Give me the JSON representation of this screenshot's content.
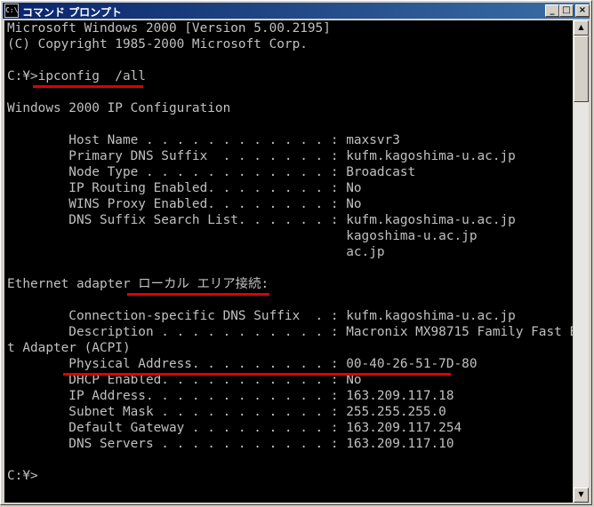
{
  "window": {
    "title": "コマンド プロンプト",
    "icon_text": "C:\\",
    "icon": "console-app-icon",
    "buttons": {
      "minimize": {
        "glyph": "_",
        "icon": "minimize-icon"
      },
      "maximize": {
        "glyph": "□",
        "icon": "maximize-icon"
      },
      "close": {
        "glyph": "×",
        "icon": "close-icon"
      }
    }
  },
  "console": {
    "lines": [
      "Microsoft Windows 2000 [Version 5.00.2195]",
      "(C) Copyright 1985-2000 Microsoft Corp.",
      "",
      "C:¥>ipconfig  /all",
      "",
      "Windows 2000 IP Configuration",
      "",
      "        Host Name . . . . . . . . . . . . : maxsvr3",
      "        Primary DNS Suffix  . . . . . . . : kufm.kagoshima-u.ac.jp",
      "        Node Type . . . . . . . . . . . . : Broadcast",
      "        IP Routing Enabled. . . . . . . . : No",
      "        WINS Proxy Enabled. . . . . . . . : No",
      "        DNS Suffix Search List. . . . . . : kufm.kagoshima-u.ac.jp",
      "                                            kagoshima-u.ac.jp",
      "                                            ac.jp",
      "",
      "Ethernet adapter ローカル エリア接続:",
      "",
      "        Connection-specific DNS Suffix  . : kufm.kagoshima-u.ac.jp",
      "        Description . . . . . . . . . . . : Macronix MX98715 Family Fast Etherne",
      "t Adapter (ACPI)",
      "        Physical Address. . . . . . . . . : 00-40-26-51-7D-80",
      "        DHCP Enabled. . . . . . . . . . . : No",
      "        IP Address. . . . . . . . . . . . : 163.209.117.18",
      "        Subnet Mask . . . . . . . . . . . : 255.255.255.0",
      "        Default Gateway . . . . . . . . . : 163.209.117.254",
      "        DNS Servers . . . . . . . . . . . : 163.209.117.10",
      "",
      "C:¥>"
    ]
  },
  "annotations": {
    "underline_color": "#e00000"
  },
  "scrollbar": {
    "up_arrow_icon": "scroll-up-arrow-icon",
    "down_arrow_icon": "scroll-down-arrow-icon",
    "up_glyph": "▲",
    "down_glyph": "▼"
  }
}
